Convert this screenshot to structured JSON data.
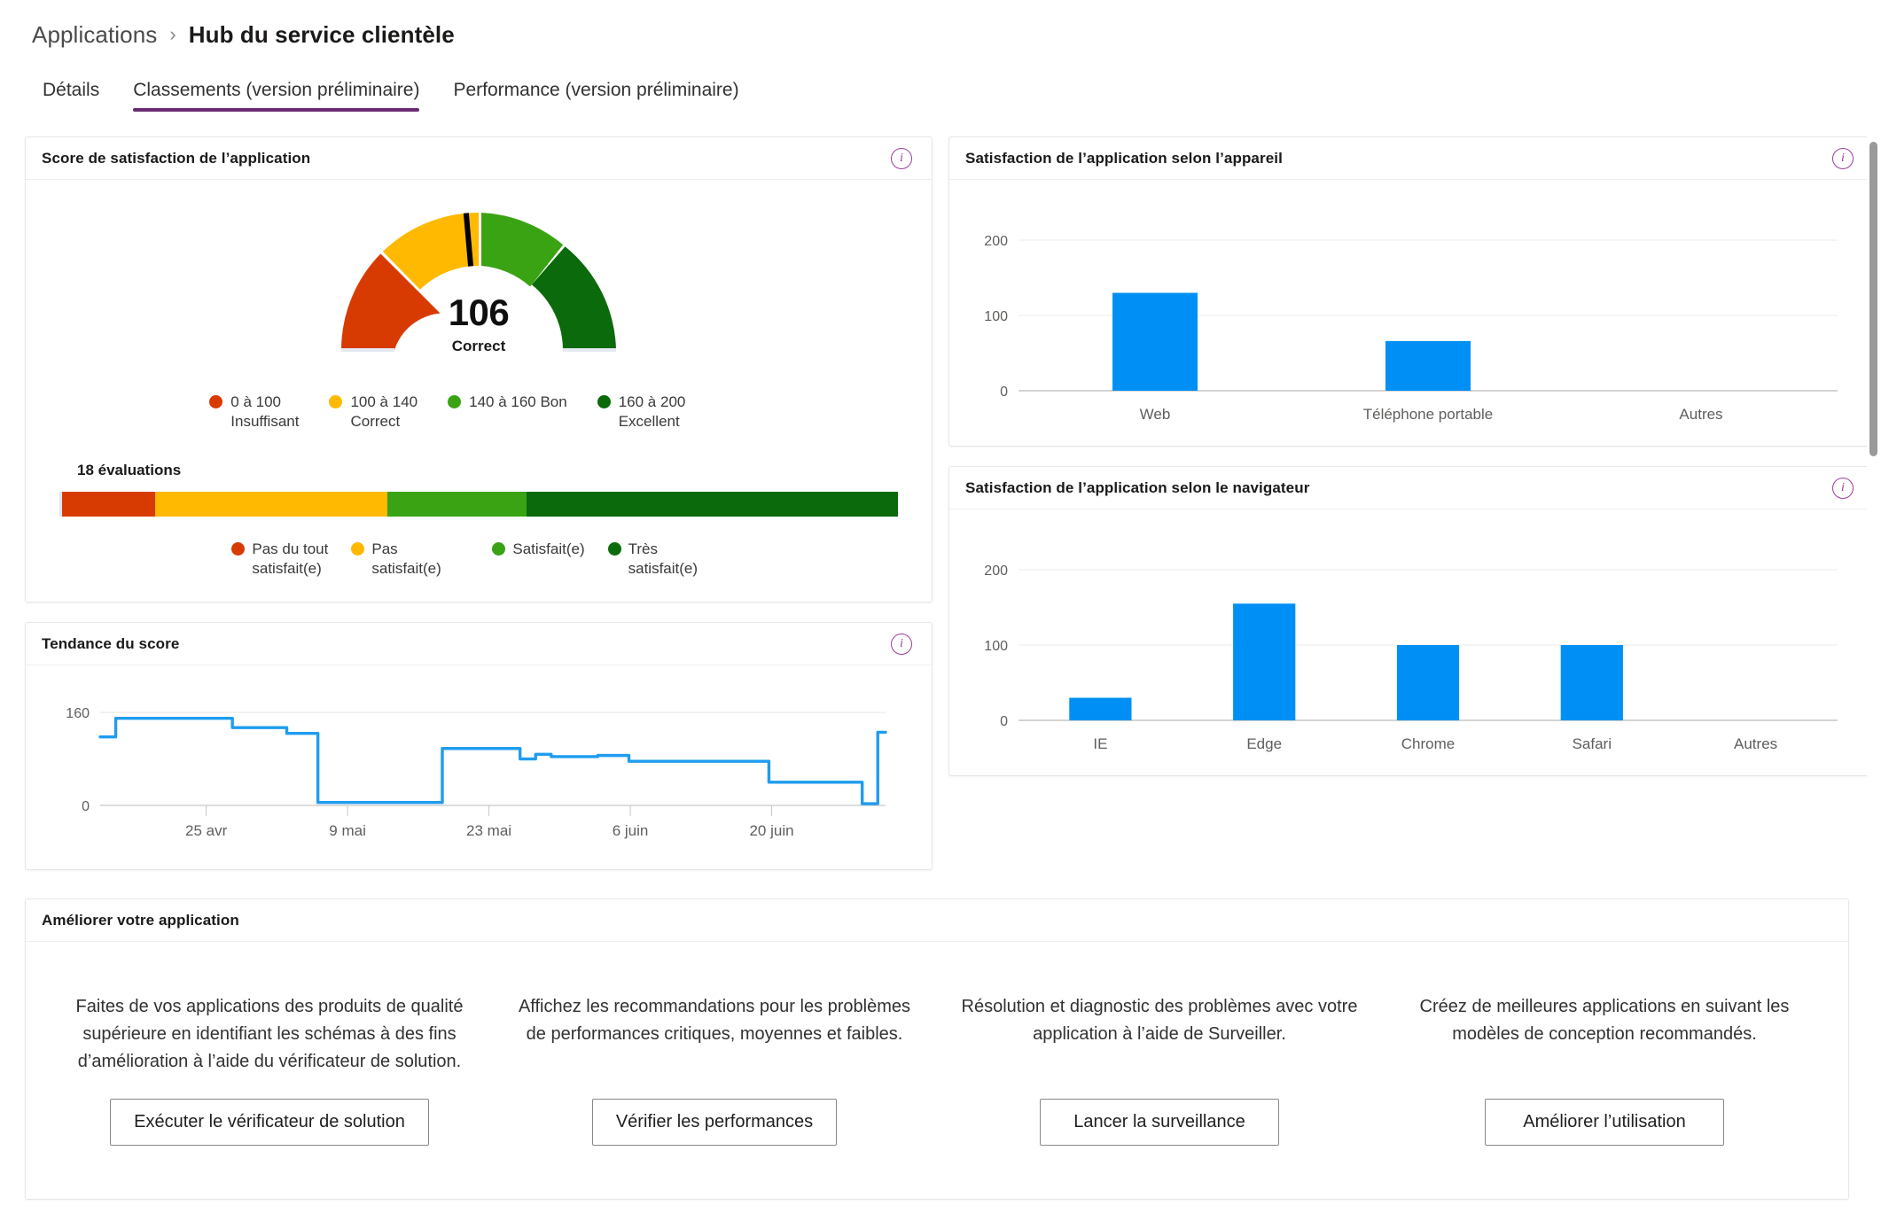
{
  "breadcrumb": {
    "parent": "Applications",
    "separator": "›",
    "current": "Hub du service clientèle"
  },
  "tabs": [
    {
      "label": "Détails",
      "active": false
    },
    {
      "label": "Classements (version préliminaire)",
      "active": true
    },
    {
      "label": "Performance (version préliminaire)",
      "active": false
    }
  ],
  "colors": {
    "accent_purple": "#6b2a73",
    "info_icon": "#9b3d9b",
    "bar_blue": "#0090f5",
    "line_blue": "#1f9cf0",
    "red": "#d83b01",
    "amber": "#ffb900",
    "green": "#3aa314",
    "dark_green": "#0b6a0b"
  },
  "cards": {
    "satisfaction_score": {
      "title": "Score de satisfaction de l’application",
      "info_icon": "info-icon",
      "evaluations_label": "18 évaluations"
    },
    "device": {
      "title": "Satisfaction de l’application selon l’appareil",
      "info_icon": "info-icon"
    },
    "browser": {
      "title": "Satisfaction de l’application selon le navigateur",
      "info_icon": "info-icon"
    },
    "trend": {
      "title": "Tendance du score",
      "info_icon": "info-icon"
    },
    "improve": {
      "title": "Améliorer votre application"
    }
  },
  "improve_items": [
    {
      "text": "Faites de vos applications des produits de qualité supérieure en identifiant les schémas à des fins d’amélioration à l’aide du vérificateur de solution.",
      "button": "Exécuter le vérificateur de solution"
    },
    {
      "text": "Affichez les recommandations pour les problèmes de performances critiques, moyennes et faibles.",
      "button": "Vérifier les performances"
    },
    {
      "text": "Résolution et diagnostic des problèmes avec votre application à l’aide de Surveiller.",
      "button": "Lancer la surveillance"
    },
    {
      "text": "Créez de meilleures applications en suivant les modèles de conception recommandés.",
      "button": "Améliorer l’utilisation"
    }
  ],
  "chart_data": [
    {
      "type": "gauge",
      "title": "Score de satisfaction de l’application",
      "value": 106,
      "value_label": "Correct",
      "min": 0,
      "max": 200,
      "bands": [
        {
          "from": 0,
          "to": 100,
          "color": "#d83b01",
          "legend_line1": "0 à 100",
          "legend_line2": "Insuffisant"
        },
        {
          "from": 100,
          "to": 140,
          "color": "#ffb900",
          "legend_line1": "100 à 140",
          "legend_line2": "Correct"
        },
        {
          "from": 140,
          "to": 160,
          "color": "#3aa314",
          "legend_line1": "140 à 160 Bon",
          "legend_line2": ""
        },
        {
          "from": 160,
          "to": 200,
          "color": "#0b6a0b",
          "legend_line1": "160 à 200 Excellent",
          "legend_line2": ""
        }
      ]
    },
    {
      "type": "bar",
      "orientation": "horizontal-stacked",
      "title": "18 évaluations",
      "total": 18,
      "categories": [
        "Pas du tout satisfait(e)",
        "Pas satisfait(e)",
        "Satisfait(e)",
        "Très satisfait(e)"
      ],
      "values": [
        2,
        5,
        3,
        8
      ],
      "percents": [
        11.1,
        27.8,
        16.7,
        44.4
      ],
      "colors": [
        "#d83b01",
        "#ffb900",
        "#3aa314",
        "#0b6a0b"
      ],
      "legend": [
        {
          "label_line1": "Pas du tout",
          "label_line2": "satisfait(e)",
          "color": "#d83b01"
        },
        {
          "label_line1": "Pas satisfait(e)",
          "label_line2": "",
          "color": "#ffb900"
        },
        {
          "label_line1": "Satisfait(e)",
          "label_line2": "",
          "color": "#3aa314"
        },
        {
          "label_line1": "Très satisfait(e)",
          "label_line2": "",
          "color": "#0b6a0b"
        }
      ]
    },
    {
      "type": "line",
      "title": "Tendance du score",
      "xlabel": "",
      "ylabel": "",
      "ylim": [
        0,
        180
      ],
      "yticks": [
        0,
        160
      ],
      "ytick_labels": [
        "0",
        "160"
      ],
      "xtick_labels": [
        "25 avr",
        "9 mai",
        "23 mai",
        "6 juin",
        "20 juin"
      ],
      "xtick_positions": [
        0.135,
        0.315,
        0.495,
        0.675,
        0.855
      ],
      "grid": true,
      "series_color": "#1f9cf0",
      "values": [
        118,
        118,
        150,
        150,
        150,
        150,
        150,
        150,
        150,
        150,
        150,
        150,
        150,
        150,
        150,
        150,
        150,
        134,
        134,
        134,
        134,
        134,
        134,
        134,
        124,
        124,
        124,
        124,
        5,
        5,
        5,
        5,
        5,
        5,
        5,
        5,
        5,
        5,
        5,
        5,
        5,
        5,
        5,
        5,
        98,
        98,
        98,
        98,
        98,
        98,
        98,
        98,
        98,
        98,
        80,
        80,
        88,
        88,
        84,
        84,
        84,
        84,
        84,
        84,
        86,
        86,
        86,
        86,
        76,
        76,
        76,
        76,
        76,
        76,
        76,
        76,
        76,
        76,
        76,
        76,
        76,
        76,
        76,
        76,
        76,
        76,
        40,
        40,
        40,
        40,
        40,
        40,
        40,
        40,
        40,
        40,
        40,
        40,
        3,
        3,
        126,
        126
      ]
    },
    {
      "type": "bar",
      "title": "Satisfaction de l’application selon l’appareil",
      "categories": [
        "Web",
        "Téléphone portable",
        "Autres"
      ],
      "values": [
        130,
        66,
        0
      ],
      "ylim": [
        0,
        240
      ],
      "yticks": [
        0,
        100,
        200
      ],
      "ytick_labels": [
        "0",
        "100",
        "200"
      ],
      "bar_color": "#0090f5",
      "grid": true
    },
    {
      "type": "bar",
      "title": "Satisfaction de l’application selon le navigateur",
      "categories": [
        "IE",
        "Edge",
        "Chrome",
        "Safari",
        "Autres"
      ],
      "values": [
        30,
        155,
        100,
        100,
        0
      ],
      "ylim": [
        0,
        240
      ],
      "yticks": [
        0,
        100,
        200
      ],
      "ytick_labels": [
        "0",
        "100",
        "200"
      ],
      "bar_color": "#0090f5",
      "grid": true
    }
  ]
}
